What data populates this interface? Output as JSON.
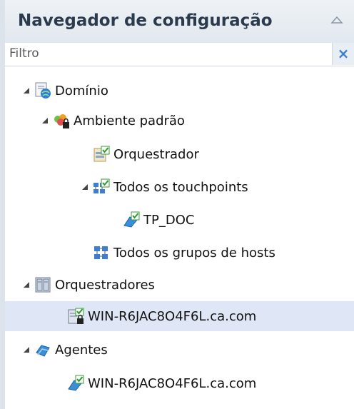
{
  "panel": {
    "title": "Navegador de configuração",
    "filter_placeholder": "Filtro",
    "clear_label": "×"
  },
  "tree": [
    {
      "label": "Domínio",
      "icon": "domain-icon",
      "expanded": true
    },
    {
      "label": "Ambiente padrão",
      "icon": "environment-lock-icon",
      "expanded": true
    },
    {
      "label": "Orquestrador",
      "icon": "orchestrator-check-icon"
    },
    {
      "label": "Todos os touchpoints",
      "icon": "touchpoints-group-icon",
      "expanded": true
    },
    {
      "label": "TP_DOC",
      "icon": "touchpoint-icon"
    },
    {
      "label": "Todos os grupos de hosts",
      "icon": "host-groups-icon"
    },
    {
      "label": "Orquestradores",
      "icon": "orchestrators-folder-icon",
      "expanded": true
    },
    {
      "label": "WIN-R6JAC8O4F6L.ca.com",
      "icon": "orchestrator-server-lock-icon",
      "selected": true
    },
    {
      "label": "Agentes",
      "icon": "agents-folder-icon",
      "expanded": true
    },
    {
      "label": "WIN-R6JAC8O4F6L.ca.com",
      "icon": "agent-icon"
    }
  ],
  "colors": {
    "header_text": "#2b3a4d",
    "selection": "#dfe6f6",
    "accent": "#3a7fd1"
  }
}
